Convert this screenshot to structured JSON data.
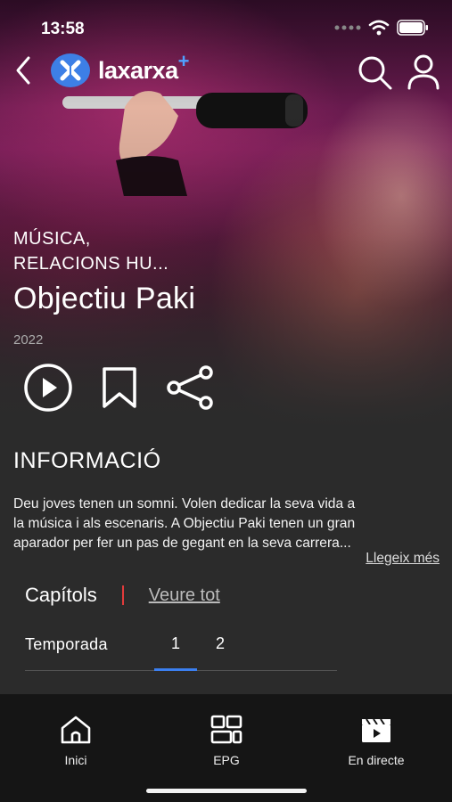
{
  "status_bar": {
    "time": "13:58"
  },
  "header": {
    "brand": "laxarxa",
    "brand_plus": "+"
  },
  "hero": {
    "genres_line1": "MÚSICA,",
    "genres_line2": "RELACIONS HU...",
    "title": "Objectiu Paki",
    "year": "2022"
  },
  "info": {
    "heading": "INFORMACIÓ",
    "desc_line1": "Deu joves tenen un somni. Volen dedicar la seva vida a",
    "desc_line2": "la música i als escenaris. A Objectiu Paki tenen un gran",
    "desc_line3": "aparador per fer un pas de gegant en la seva carrera...",
    "read_more": "Llegeix més"
  },
  "chapters": {
    "label": "Capítols",
    "see_all": "Veure tot"
  },
  "seasons": {
    "label": "Temporada",
    "tabs": [
      "1",
      "2"
    ],
    "active": "1"
  },
  "bottom_nav": {
    "items": [
      {
        "label": "Inici",
        "icon": "home-icon"
      },
      {
        "label": "EPG",
        "icon": "grid-icon"
      },
      {
        "label": "En directe",
        "icon": "clapperboard-icon"
      }
    ]
  },
  "colors": {
    "background": "#2b2b2b",
    "accent": "#3b7ff0",
    "separator": "#e23b3b",
    "bottom_bar": "#151515"
  }
}
